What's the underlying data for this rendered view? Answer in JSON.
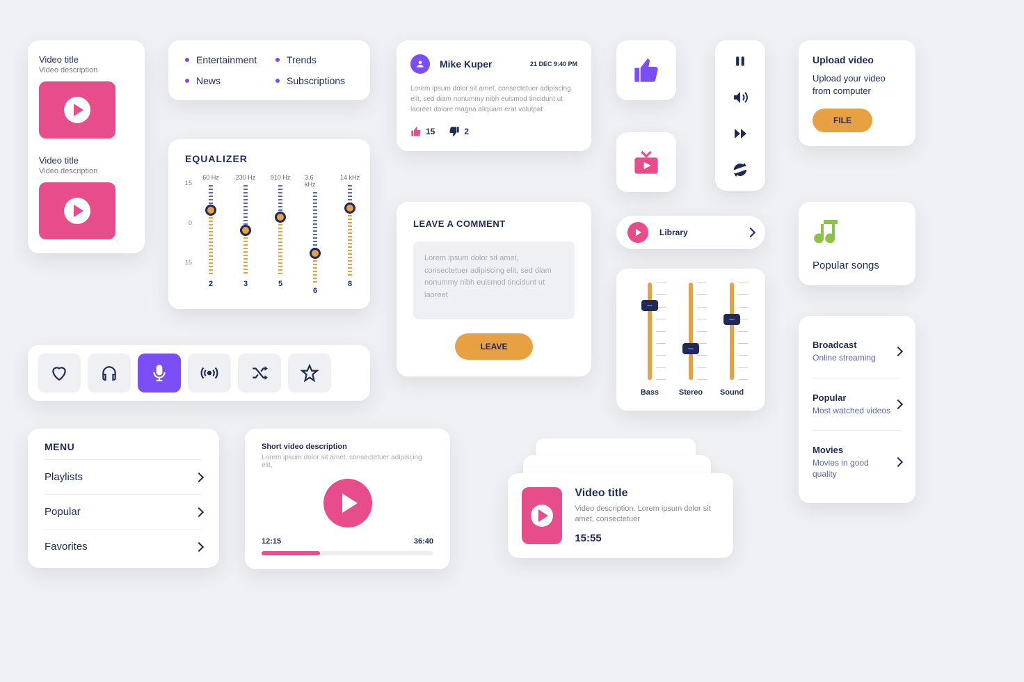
{
  "videoCards": [
    {
      "title": "Video title",
      "desc": "Video description"
    },
    {
      "title": "Video title",
      "desc": "Video description"
    }
  ],
  "categories": [
    "Entertainment",
    "Trends",
    "News",
    "Subscriptions"
  ],
  "comment": {
    "name": "Mike Kuper",
    "date": "21 DEC 9:40 PM",
    "body": "Lorem ipsum dolor sit amet, consectetuer adipiscing elit, sed diam nonummy nibh euismod tincidunt ut laoreet dolore magna aliquam erat volutpat",
    "likes": "15",
    "dislikes": "2"
  },
  "upload": {
    "title": "Upload video",
    "desc": "Upload your video from computer",
    "button": "FILE"
  },
  "equalizer": {
    "title": "EQUALIZER",
    "scale": [
      "15",
      "0",
      "15"
    ],
    "bands": [
      {
        "hz": "60 Hz",
        "num": "2",
        "pos": 28
      },
      {
        "hz": "230 Hz",
        "num": "3",
        "pos": 50
      },
      {
        "hz": "910 Hz",
        "num": "5",
        "pos": 35
      },
      {
        "hz": "3.6 kHz",
        "num": "6",
        "pos": 68
      },
      {
        "hz": "14 kHz",
        "num": "8",
        "pos": 25
      }
    ]
  },
  "leaveComment": {
    "title": "LEAVE A COMMENT",
    "placeholder": "Lorem ipsum dolor sit amet, consectetuer adipiscing elit, sed diam nonummy nibh euismod tincidunt ut laoreet",
    "button": "LEAVE"
  },
  "library": {
    "label": "Library"
  },
  "sliders": [
    {
      "label": "Bass",
      "pos": 18
    },
    {
      "label": "Stereo",
      "pos": 62
    },
    {
      "label": "Sound",
      "pos": 32
    }
  ],
  "popularSongs": {
    "title": "Popular songs"
  },
  "menu": {
    "title": "MENU",
    "items": [
      "Playlists",
      "Popular",
      "Favorites"
    ]
  },
  "miniPlayer": {
    "title": "Short video description",
    "desc": "Lorem ipsum dolor sit amet, consectetuer adipiscing elit,",
    "start": "12:15",
    "end": "36:40"
  },
  "stackedVideo": {
    "title": "Video title",
    "desc": "Video description. Lorem ipsum dolor sit amet, consectetuer",
    "duration": "15:55"
  },
  "rightList": [
    {
      "title": "Broadcast",
      "desc": "Online streaming"
    },
    {
      "title": "Popular",
      "desc": "Most watched videos"
    },
    {
      "title": "Movies",
      "desc": "Movies in good quality"
    }
  ]
}
